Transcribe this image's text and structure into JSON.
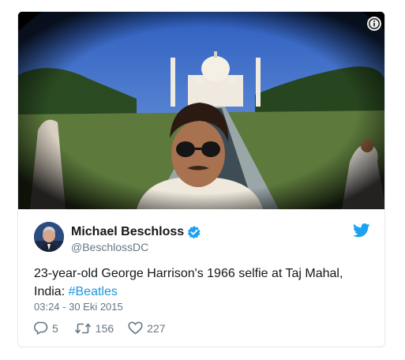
{
  "tweet": {
    "author": {
      "display_name": "Michael Beschloss",
      "handle": "@BeschlossDC",
      "verified": true
    },
    "text_main": "23-year-old George Harrison's 1966 selfie at Taj Mahal, India: ",
    "hashtag": "#Beatles",
    "timestamp": "03:24 - 30 Eki 2015",
    "actions": {
      "replies": "5",
      "retweets": "156",
      "likes": "227"
    }
  },
  "icons": {
    "info": "info-icon",
    "verified": "verified-badge-icon",
    "brand": "twitter-bird-icon",
    "reply": "reply-icon",
    "retweet": "retweet-icon",
    "like": "heart-icon"
  },
  "colors": {
    "accent": "#1da1f2",
    "hashtag": "#1b95e0",
    "secondary_text": "#657786",
    "primary_text": "#14171a",
    "border": "#e1e8ed"
  }
}
